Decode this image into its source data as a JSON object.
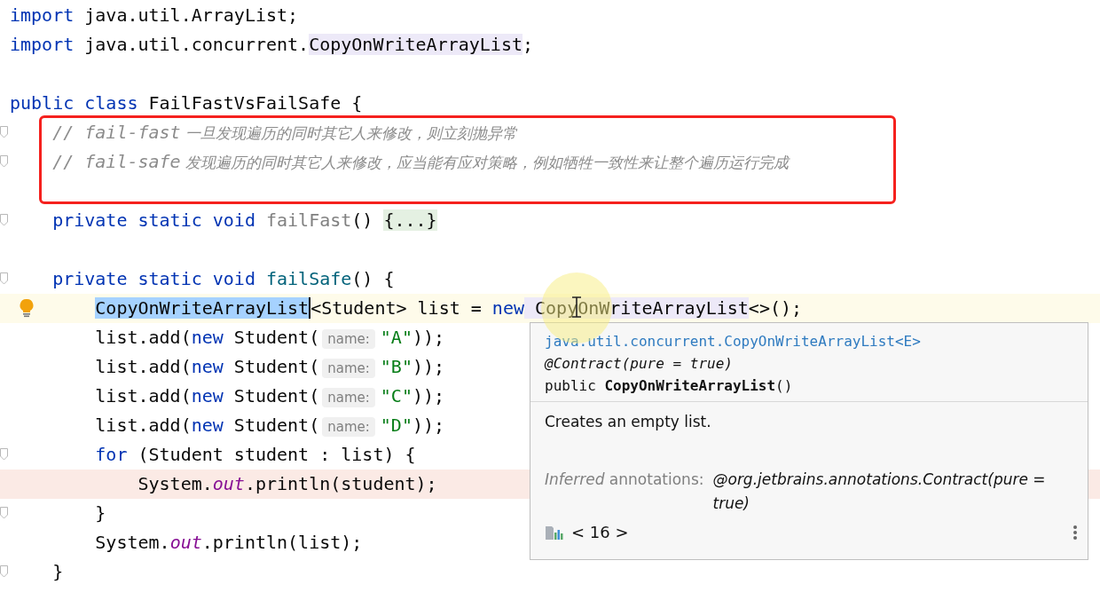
{
  "editor": {
    "lines": [
      {
        "tokens": [
          {
            "kind": "kw",
            "text": "import"
          },
          {
            "kind": "plain",
            "text": " java.util.ArrayList;"
          }
        ]
      },
      {
        "tokens": [
          {
            "kind": "kw",
            "text": "import"
          },
          {
            "kind": "plain",
            "text": " java.util.concurrent."
          },
          {
            "kind": "usage",
            "text": "CopyOnWriteArrayList"
          },
          {
            "kind": "plain",
            "text": ";"
          }
        ]
      },
      {
        "gap_before": true,
        "tokens": [
          {
            "kind": "kw",
            "text": "public class"
          },
          {
            "kind": "plain",
            "text": " FailFastVsFailSafe {"
          }
        ],
        "children": [
          {
            "fold": true,
            "boxed": true,
            "tokens": [
              {
                "kind": "comment",
                "text": "// fail-fast"
              },
              {
                "kind": "comment-cjk",
                "text": " 一旦发现遍历的同时其它人来修改，则立刻抛异常"
              }
            ]
          },
          {
            "fold": true,
            "boxed": true,
            "tokens": [
              {
                "kind": "comment",
                "text": "// fail-safe"
              },
              {
                "kind": "comment-cjk",
                "text": " 发现遍历的同时其它人来修改，应当能有应对策略，例如牺牲一致性来让整个遍历运行完成"
              }
            ]
          },
          {
            "fold": true,
            "gap_before": true,
            "tokens": [
              {
                "kind": "kw",
                "text": "private static void"
              },
              {
                "kind": "unused",
                "text": " failFast"
              },
              {
                "kind": "plain",
                "text": "() "
              },
              {
                "kind": "folded",
                "text": "{...}"
              }
            ]
          },
          {
            "fold": true,
            "gap_before": true,
            "tokens": [
              {
                "kind": "kw",
                "text": "private static void"
              },
              {
                "kind": "method",
                "text": " failSafe"
              },
              {
                "kind": "plain",
                "text": "() {"
              }
            ],
            "children": [
              {
                "current": true,
                "bulb": true,
                "tokens": [
                  {
                    "kind": "selected",
                    "text": "CopyOnWriteArrayList"
                  },
                  {
                    "kind": "plain",
                    "text": "<Student> list = "
                  },
                  {
                    "kind": "kw",
                    "text": "new"
                  },
                  {
                    "kind": "usage",
                    "text": " CopyOnWriteArrayList"
                  },
                  {
                    "kind": "plain",
                    "text": "<>();"
                  }
                ]
              },
              {
                "tokens": [
                  {
                    "kind": "plain",
                    "text": "list.add("
                  },
                  {
                    "kind": "kw",
                    "text": "new"
                  },
                  {
                    "kind": "plain",
                    "text": " Student("
                  },
                  {
                    "kind": "hint",
                    "text": "name:"
                  },
                  {
                    "kind": "str",
                    "text": "\"A\""
                  },
                  {
                    "kind": "plain",
                    "text": "));"
                  }
                ]
              },
              {
                "tokens": [
                  {
                    "kind": "plain",
                    "text": "list.add("
                  },
                  {
                    "kind": "kw",
                    "text": "new"
                  },
                  {
                    "kind": "plain",
                    "text": " Student("
                  },
                  {
                    "kind": "hint",
                    "text": "name:"
                  },
                  {
                    "kind": "str",
                    "text": "\"B\""
                  },
                  {
                    "kind": "plain",
                    "text": "));"
                  }
                ]
              },
              {
                "tokens": [
                  {
                    "kind": "plain",
                    "text": "list.add("
                  },
                  {
                    "kind": "kw",
                    "text": "new"
                  },
                  {
                    "kind": "plain",
                    "text": " Student("
                  },
                  {
                    "kind": "hint",
                    "text": "name:"
                  },
                  {
                    "kind": "str",
                    "text": "\"C\""
                  },
                  {
                    "kind": "plain",
                    "text": "));"
                  }
                ]
              },
              {
                "tokens": [
                  {
                    "kind": "plain",
                    "text": "list.add("
                  },
                  {
                    "kind": "kw",
                    "text": "new"
                  },
                  {
                    "kind": "plain",
                    "text": " Student("
                  },
                  {
                    "kind": "hint",
                    "text": "name:"
                  },
                  {
                    "kind": "str",
                    "text": "\"D\""
                  },
                  {
                    "kind": "plain",
                    "text": "));"
                  }
                ]
              },
              {
                "fold": true,
                "tokens": [
                  {
                    "kind": "kw",
                    "text": "for"
                  },
                  {
                    "kind": "plain",
                    "text": " (Student student : list) {"
                  }
                ],
                "children": [
                  {
                    "breakpoint": true,
                    "tokens": [
                      {
                        "kind": "plain",
                        "text": "System."
                      },
                      {
                        "kind": "field",
                        "text": "out"
                      },
                      {
                        "kind": "plain",
                        "text": ".println(student);"
                      }
                    ]
                  }
                ]
              },
              {
                "fold": true,
                "tokens": [
                  {
                    "kind": "plain",
                    "text": "}"
                  }
                ]
              },
              {
                "tokens": [
                  {
                    "kind": "plain",
                    "text": "System."
                  },
                  {
                    "kind": "field",
                    "text": "out"
                  },
                  {
                    "kind": "plain",
                    "text": ".println(list);"
                  }
                ]
              }
            ]
          },
          {
            "fold": true,
            "tokens": [
              {
                "kind": "plain",
                "text": "}"
              }
            ]
          }
        ]
      }
    ]
  },
  "popup": {
    "qualified_name": "java.util.concurrent.CopyOnWriteArrayList<E>",
    "annotation": "@Contract(pure = true)",
    "signature_prefix": "public ",
    "signature_name": "CopyOnWriteArrayList",
    "signature_suffix": "()",
    "description": "Creates an empty list.",
    "inferred_label": "*Inferred* annotations:",
    "inferred_value": "@org.jetbrains.annotations.Contract(pure = true)",
    "version": "< 16 >"
  }
}
